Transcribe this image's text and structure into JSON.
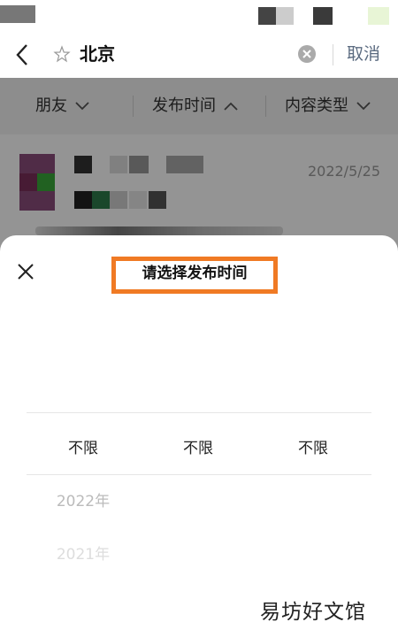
{
  "search": {
    "query": "北京",
    "cancel_label": "取消"
  },
  "filters": [
    {
      "label": "朋友",
      "chevron": "chevron-down-icon",
      "active": false
    },
    {
      "label": "发布时间",
      "chevron": "chevron-up-icon",
      "active": true
    },
    {
      "label": "内容类型",
      "chevron": "chevron-down-icon",
      "active": false
    }
  ],
  "feed": {
    "post_date": "2022/5/25"
  },
  "sheet": {
    "title": "请选择发布时间",
    "columns": [
      "不限",
      "不限",
      "不限"
    ],
    "years": [
      "2022年",
      "2021年"
    ]
  },
  "watermark": "易坊好文馆",
  "colors": {
    "highlight_border": "#f07a24",
    "cancel": "#5b6b80",
    "overlay": "rgba(0,0,0,0.42)"
  }
}
